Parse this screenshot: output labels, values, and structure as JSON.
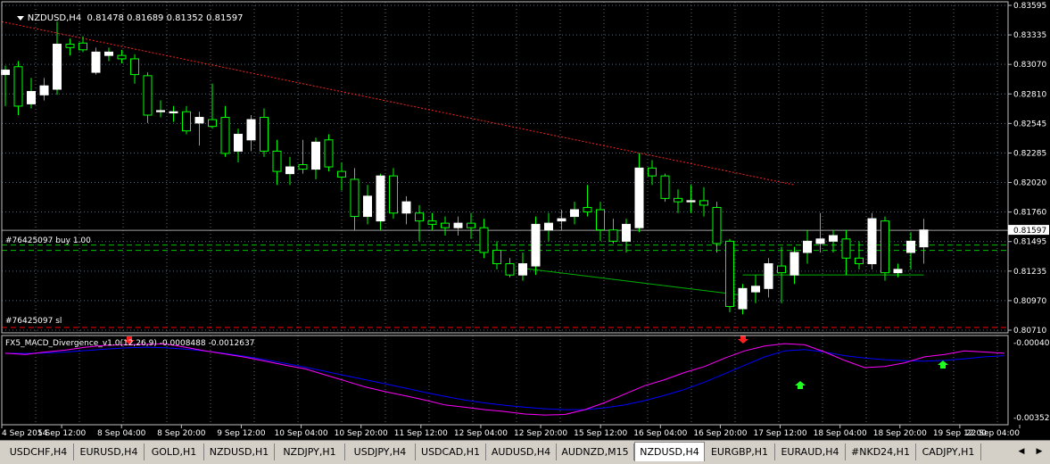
{
  "symbol_header": "NZDUSD,H4  0.81478 0.81689 0.81352 0.81597",
  "indicator_header": "FX5_MACD_Divergence_v1.0(12,26,9) -0.0008488 -0.0012637",
  "order_labels": {
    "buy": "#76425097 buy 1.00",
    "sl": "#76425097 sl"
  },
  "price_labels": [
    "0.83595",
    "0.83335",
    "0.83070",
    "0.82810",
    "0.82545",
    "0.82285",
    "0.82020",
    "0.81760",
    "0.81495",
    "0.81235",
    "0.80970",
    "0.80710"
  ],
  "current_price_label": "0.81597",
  "indicator_labels": {
    "top": "-0.000409",
    "bottom": "-0.003529"
  },
  "time_labels": [
    "4 Sep 2014",
    "5 Sep 12:00",
    "8 Sep 04:00",
    "8 Sep 20:00",
    "9 Sep 12:00",
    "10 Sep 04:00",
    "10 Sep 20:00",
    "11 Sep 12:00",
    "12 Sep 04:00",
    "12 Sep 20:00",
    "15 Sep 12:00",
    "16 Sep 04:00",
    "16 Sep 20:00",
    "17 Sep 12:00",
    "18 Sep 04:00",
    "18 Sep 20:00",
    "19 Sep 12:00",
    "22 Sep 04:00"
  ],
  "tabs": [
    "USDCHF,H4",
    "EURUSD,H4",
    "GOLD,H1",
    "NZDUSD,H1",
    "NZDJPY,H1",
    "USDJPY,H4",
    "USDCAD,H1",
    "AUDUSD,H4",
    "AUDNZD,M15",
    "NZDUSD,H4",
    "EURGBP,H1",
    "EURAUD,H4",
    "#NKD24,H1",
    "CADJPY,H1"
  ],
  "active_tab_index": 9,
  "colors": {
    "background": "#000000",
    "grid": "#5a6a78",
    "bull": "#ffffff",
    "bear": "#000000",
    "wick": "#00ff00",
    "trendline": "#ff2020",
    "divergence_line": "#00b000",
    "macd_line": "#ff00ff",
    "signal_line": "#0000ff",
    "order_line": "#00c000",
    "sl_line": "#ff0000",
    "tabbar": "#d4d0c8"
  },
  "chart_data": {
    "type": "candlestick",
    "symbol": "NZDUSD",
    "timeframe": "H4",
    "ylim": [
      0.8071,
      0.83595
    ],
    "current_price": 0.81597,
    "buy_price": 0.8145,
    "sl_price": 0.8071,
    "candles": [
      {
        "o": 0.8298,
        "h": 0.8306,
        "l": 0.827,
        "c": 0.8302
      },
      {
        "o": 0.8305,
        "h": 0.831,
        "l": 0.8262,
        "c": 0.827
      },
      {
        "o": 0.8272,
        "h": 0.8295,
        "l": 0.8268,
        "c": 0.8283
      },
      {
        "o": 0.828,
        "h": 0.8295,
        "l": 0.8275,
        "c": 0.8288
      },
      {
        "o": 0.8285,
        "h": 0.8345,
        "l": 0.828,
        "c": 0.8325
      },
      {
        "o": 0.8325,
        "h": 0.833,
        "l": 0.8315,
        "c": 0.8322
      },
      {
        "o": 0.8326,
        "h": 0.8332,
        "l": 0.8318,
        "c": 0.832
      },
      {
        "o": 0.83,
        "h": 0.8322,
        "l": 0.8298,
        "c": 0.8318
      },
      {
        "o": 0.8315,
        "h": 0.8322,
        "l": 0.831,
        "c": 0.8318
      },
      {
        "o": 0.8315,
        "h": 0.832,
        "l": 0.8308,
        "c": 0.8312
      },
      {
        "o": 0.8312,
        "h": 0.8316,
        "l": 0.829,
        "c": 0.8298
      },
      {
        "o": 0.8297,
        "h": 0.83,
        "l": 0.8255,
        "c": 0.8262
      },
      {
        "o": 0.8265,
        "h": 0.8275,
        "l": 0.826,
        "c": 0.8266
      },
      {
        "o": 0.8264,
        "h": 0.827,
        "l": 0.8256,
        "c": 0.8265
      },
      {
        "o": 0.8265,
        "h": 0.827,
        "l": 0.8245,
        "c": 0.8248
      },
      {
        "o": 0.8255,
        "h": 0.8265,
        "l": 0.8235,
        "c": 0.826
      },
      {
        "o": 0.8258,
        "h": 0.829,
        "l": 0.825,
        "c": 0.8252
      },
      {
        "o": 0.826,
        "h": 0.827,
        "l": 0.8225,
        "c": 0.8228
      },
      {
        "o": 0.823,
        "h": 0.825,
        "l": 0.822,
        "c": 0.8245
      },
      {
        "o": 0.824,
        "h": 0.8262,
        "l": 0.823,
        "c": 0.8258
      },
      {
        "o": 0.826,
        "h": 0.8268,
        "l": 0.8225,
        "c": 0.823
      },
      {
        "o": 0.823,
        "h": 0.824,
        "l": 0.82,
        "c": 0.8212
      },
      {
        "o": 0.821,
        "h": 0.8225,
        "l": 0.82,
        "c": 0.8216
      },
      {
        "o": 0.8218,
        "h": 0.824,
        "l": 0.821,
        "c": 0.8214
      },
      {
        "o": 0.8214,
        "h": 0.8242,
        "l": 0.8205,
        "c": 0.8238
      },
      {
        "o": 0.824,
        "h": 0.8245,
        "l": 0.8212,
        "c": 0.8216
      },
      {
        "o": 0.8212,
        "h": 0.822,
        "l": 0.8195,
        "c": 0.8207
      },
      {
        "o": 0.8205,
        "h": 0.8215,
        "l": 0.816,
        "c": 0.8172
      },
      {
        "o": 0.8172,
        "h": 0.82,
        "l": 0.8165,
        "c": 0.819
      },
      {
        "o": 0.8168,
        "h": 0.821,
        "l": 0.816,
        "c": 0.8208
      },
      {
        "o": 0.8208,
        "h": 0.8215,
        "l": 0.817,
        "c": 0.8175
      },
      {
        "o": 0.8175,
        "h": 0.819,
        "l": 0.8165,
        "c": 0.8185
      },
      {
        "o": 0.8175,
        "h": 0.8182,
        "l": 0.815,
        "c": 0.8168
      },
      {
        "o": 0.8168,
        "h": 0.8175,
        "l": 0.816,
        "c": 0.8165
      },
      {
        "o": 0.8166,
        "h": 0.8172,
        "l": 0.8155,
        "c": 0.8162
      },
      {
        "o": 0.8162,
        "h": 0.8172,
        "l": 0.8155,
        "c": 0.8166
      },
      {
        "o": 0.8166,
        "h": 0.8175,
        "l": 0.8152,
        "c": 0.8162
      },
      {
        "o": 0.8162,
        "h": 0.817,
        "l": 0.8135,
        "c": 0.814
      },
      {
        "o": 0.8142,
        "h": 0.815,
        "l": 0.8125,
        "c": 0.813
      },
      {
        "o": 0.813,
        "h": 0.8135,
        "l": 0.8118,
        "c": 0.812
      },
      {
        "o": 0.812,
        "h": 0.814,
        "l": 0.8115,
        "c": 0.813
      },
      {
        "o": 0.8128,
        "h": 0.8172,
        "l": 0.812,
        "c": 0.8165
      },
      {
        "o": 0.816,
        "h": 0.8175,
        "l": 0.815,
        "c": 0.8166
      },
      {
        "o": 0.8168,
        "h": 0.8178,
        "l": 0.816,
        "c": 0.817
      },
      {
        "o": 0.8172,
        "h": 0.8185,
        "l": 0.8165,
        "c": 0.8178
      },
      {
        "o": 0.818,
        "h": 0.82,
        "l": 0.8172,
        "c": 0.8176
      },
      {
        "o": 0.8178,
        "h": 0.8185,
        "l": 0.815,
        "c": 0.816
      },
      {
        "o": 0.816,
        "h": 0.817,
        "l": 0.8148,
        "c": 0.815
      },
      {
        "o": 0.815,
        "h": 0.817,
        "l": 0.814,
        "c": 0.8165
      },
      {
        "o": 0.8162,
        "h": 0.8228,
        "l": 0.8158,
        "c": 0.8215
      },
      {
        "o": 0.8215,
        "h": 0.8222,
        "l": 0.82,
        "c": 0.8208
      },
      {
        "o": 0.8208,
        "h": 0.821,
        "l": 0.8185,
        "c": 0.8188
      },
      {
        "o": 0.8188,
        "h": 0.8196,
        "l": 0.8175,
        "c": 0.8185
      },
      {
        "o": 0.8185,
        "h": 0.82,
        "l": 0.8175,
        "c": 0.8186
      },
      {
        "o": 0.8186,
        "h": 0.8198,
        "l": 0.8172,
        "c": 0.8182
      },
      {
        "o": 0.818,
        "h": 0.8185,
        "l": 0.814,
        "c": 0.8148
      },
      {
        "o": 0.815,
        "h": 0.8152,
        "l": 0.8087,
        "c": 0.8092
      },
      {
        "o": 0.809,
        "h": 0.8112,
        "l": 0.8085,
        "c": 0.8108
      },
      {
        "o": 0.8105,
        "h": 0.812,
        "l": 0.8095,
        "c": 0.811
      },
      {
        "o": 0.8108,
        "h": 0.8135,
        "l": 0.81,
        "c": 0.813
      },
      {
        "o": 0.8128,
        "h": 0.8145,
        "l": 0.8095,
        "c": 0.8122
      },
      {
        "o": 0.812,
        "h": 0.8145,
        "l": 0.8112,
        "c": 0.814
      },
      {
        "o": 0.814,
        "h": 0.816,
        "l": 0.813,
        "c": 0.815
      },
      {
        "o": 0.8148,
        "h": 0.8175,
        "l": 0.814,
        "c": 0.8152
      },
      {
        "o": 0.815,
        "h": 0.816,
        "l": 0.814,
        "c": 0.8155
      },
      {
        "o": 0.8152,
        "h": 0.816,
        "l": 0.812,
        "c": 0.8135
      },
      {
        "o": 0.8135,
        "h": 0.815,
        "l": 0.8125,
        "c": 0.813
      },
      {
        "o": 0.813,
        "h": 0.8175,
        "l": 0.8125,
        "c": 0.817
      },
      {
        "o": 0.8168,
        "h": 0.8172,
        "l": 0.8115,
        "c": 0.8122
      },
      {
        "o": 0.8122,
        "h": 0.813,
        "l": 0.8118,
        "c": 0.8125
      },
      {
        "o": 0.814,
        "h": 0.8158,
        "l": 0.8125,
        "c": 0.815
      },
      {
        "o": 0.8145,
        "h": 0.817,
        "l": 0.813,
        "c": 0.816
      }
    ],
    "trendline": {
      "from": 0.8345,
      "to": 0.82
    },
    "divergence_line": {
      "from": 0.8126,
      "to": 0.8102
    },
    "macd": [
      -0.00085,
      -0.0009,
      -0.0008,
      -0.00072,
      -0.0006,
      -0.00052,
      -0.0005,
      -0.00048,
      -0.00046,
      -0.0006,
      -0.00075,
      -0.00088,
      -0.00102,
      -0.00118,
      -0.00135,
      -0.0015,
      -0.00175,
      -0.002,
      -0.00225,
      -0.00245,
      -0.00262,
      -0.0028,
      -0.003,
      -0.0031,
      -0.0032,
      -0.00328,
      -0.00338,
      -0.00342,
      -0.0034,
      -0.0032,
      -0.0029,
      -0.00255,
      -0.0022,
      -0.00195,
      -0.00165,
      -0.0014,
      -0.00105,
      -0.00075,
      -0.00055,
      -0.00045,
      -0.0005,
      -0.0008,
      -0.00115,
      -0.00145,
      -0.0014,
      -0.00125,
      -0.001,
      -0.0009,
      -0.00075,
      -0.0008,
      -0.00085
    ],
    "signal": [
      -0.00085,
      -0.00086,
      -0.00084,
      -0.0008,
      -0.00074,
      -0.00068,
      -0.00063,
      -0.0006,
      -0.00062,
      -0.00068,
      -0.00076,
      -0.00086,
      -0.00098,
      -0.00112,
      -0.00127,
      -0.00143,
      -0.0016,
      -0.00178,
      -0.00195,
      -0.00212,
      -0.0023,
      -0.00248,
      -0.00265,
      -0.0028,
      -0.00292,
      -0.00302,
      -0.0031,
      -0.00316,
      -0.0032,
      -0.0032,
      -0.00312,
      -0.003,
      -0.00282,
      -0.0026,
      -0.00235,
      -0.00205,
      -0.0017,
      -0.00135,
      -0.001,
      -0.00075,
      -0.0007,
      -0.0008,
      -0.00095,
      -0.00105,
      -0.00112,
      -0.00116,
      -0.00118,
      -0.00115,
      -0.00108,
      -0.001,
      -0.00095
    ],
    "macd_ylim": [
      -0.003529,
      -0.000409
    ]
  }
}
